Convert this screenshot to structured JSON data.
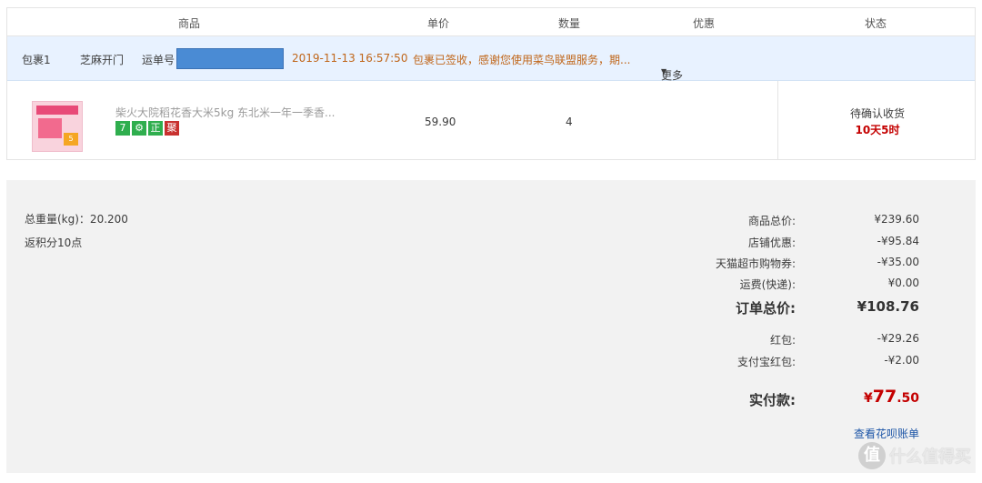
{
  "table_header": {
    "product": "商品",
    "unit_price": "单价",
    "quantity": "数量",
    "discount": "优惠",
    "status": "状态"
  },
  "package": {
    "label": "包裹1",
    "carrier": "芝麻开门",
    "tracking_label": "运单号",
    "timestamp": "2019-11-13 16:57:50",
    "message": "包裹已签收，感谢您使用菜鸟联盟服务，期...",
    "more": "更多"
  },
  "item": {
    "name": "柴火大院稻花香大米5kg 东北米一年一季香...",
    "tags": [
      "7",
      "⚙",
      "正",
      "聚"
    ],
    "price": "59.90",
    "quantity": "4",
    "status": "待确认收货",
    "countdown": "10天5时"
  },
  "summary": {
    "weight": "总重量(kg)：20.200",
    "points": "返积分10点",
    "rows": [
      {
        "label": "商品总价:",
        "value": "¥239.60"
      },
      {
        "label": "店铺优惠:",
        "value": "-¥95.84"
      },
      {
        "label": "天猫超市购物券:",
        "value": "-¥35.00"
      },
      {
        "label": "运费(快递):",
        "value": "¥0.00"
      },
      {
        "label": "订单总价:",
        "value": "¥108.76"
      },
      {
        "label": "红包:",
        "value": "-¥29.26"
      },
      {
        "label": "支付宝红包:",
        "value": "-¥2.00"
      }
    ],
    "paid_label": "实付款:",
    "paid_currency": "¥",
    "paid_integer": "77",
    "paid_decimal": ".50",
    "huabei_link": "查看花呗账单"
  },
  "watermark": {
    "symbol": "值",
    "text": "什么值得买"
  },
  "colors": {
    "package_bg": "#e8f2ff",
    "status_red": "#c40000",
    "message_orange": "#c0661a",
    "link_blue": "#1b54a6",
    "summary_bg": "#f2f2f2"
  }
}
